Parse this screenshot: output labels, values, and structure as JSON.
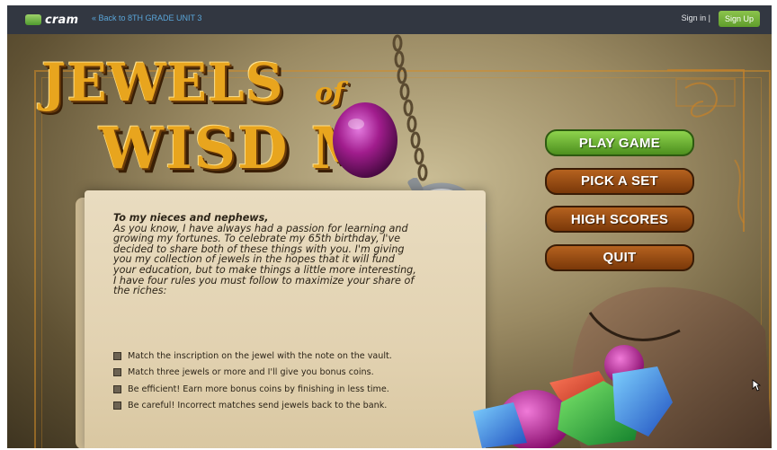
{
  "topbar": {
    "logo_text": "cram",
    "back_link": "« Back to 8TH GRADE UNIT 3",
    "sign_in": "Sign in |",
    "sign_up": "Sign Up"
  },
  "game": {
    "title_line1": "JEWELS",
    "title_of": "of",
    "title_line2": "WISD M",
    "menu": {
      "play": "PLAY GAME",
      "pick_set": "PICK A SET",
      "high_scores": "HIGH SCORES",
      "quit": "QUIT"
    },
    "note": {
      "greeting": "To my nieces and nephews,",
      "body": "As you know, I have always had a passion for learning and growing my fortunes. To celebrate my 65th birthday, I've decided to share both of these things with you. I'm giving you my collection of jewels in the hopes that it will fund your education, but to make things a little more interesting, I have four rules you must follow to maximize your share of the riches:"
    },
    "rules": [
      "Match the inscription on the jewel with the note on the vault.",
      "Match three jewels or more and I'll give you bonus coins.",
      "Be efficient! Earn more bonus coins by finishing in less time.",
      "Be careful! Incorrect matches send jewels back to the bank."
    ]
  },
  "colors": {
    "topbar_bg": "#323741",
    "link_blue": "#5aa6d9",
    "signup_green": "#7bb440",
    "title_gold": "#e8a51e",
    "play_green": "#6fb83a",
    "menu_brown": "#9a4a14"
  },
  "icons": [
    "cram-logo-icon",
    "chain-icon",
    "magnifier-icon",
    "purple-gem-icon",
    "jewel-bag-icon",
    "mouse-cursor-icon"
  ]
}
